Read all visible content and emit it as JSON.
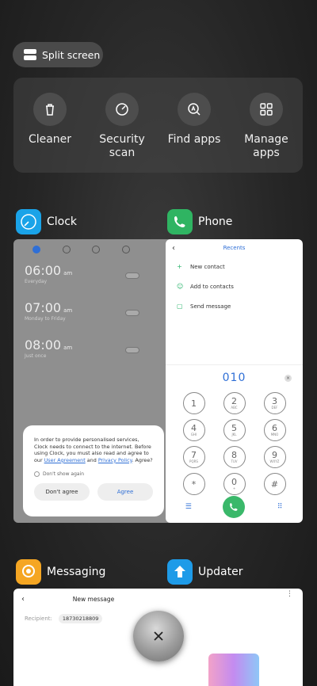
{
  "split_screen": {
    "label": "Split screen"
  },
  "quick_actions": [
    {
      "label": "Cleaner",
      "icon": "trash-icon"
    },
    {
      "label": "Security\nscan",
      "icon": "gauge-icon"
    },
    {
      "label": "Find apps",
      "icon": "search-icon"
    },
    {
      "label": "Manage\napps",
      "icon": "grid-icon"
    }
  ],
  "apps": {
    "clock": {
      "name": "Clock",
      "icon_color": "#1aa3e8",
      "alarms": [
        {
          "time": "06:00",
          "ampm": "am",
          "sub": "Everyday"
        },
        {
          "time": "07:00",
          "ampm": "am",
          "sub": "Monday to Friday"
        },
        {
          "time": "08:00",
          "ampm": "am",
          "sub": "Just once"
        }
      ],
      "dialog": {
        "message_start": "In order to provide personalised services, Clock needs to connect to the internet. Before using Clock, you must also read and agree to our ",
        "link1": "User Agreement",
        "and": " and ",
        "link2": "Privacy Policy",
        "message_end": ". Agree?",
        "checkbox": "Don't show again",
        "disagree": "Don't agree",
        "agree": "Agree"
      }
    },
    "phone": {
      "name": "Phone",
      "icon_color": "#2fb462",
      "title": "Recents",
      "rows": [
        "New contact",
        "Add to contacts",
        "Send message"
      ],
      "dialed": "010",
      "keys": [
        {
          "d": "1",
          "l": ""
        },
        {
          "d": "2",
          "l": "ABC"
        },
        {
          "d": "3",
          "l": "DEF"
        },
        {
          "d": "4",
          "l": "GHI"
        },
        {
          "d": "5",
          "l": "JKL"
        },
        {
          "d": "6",
          "l": "MNO"
        },
        {
          "d": "7",
          "l": "PQRS"
        },
        {
          "d": "8",
          "l": "TUV"
        },
        {
          "d": "9",
          "l": "WXYZ"
        },
        {
          "d": "*",
          "l": ""
        },
        {
          "d": "0",
          "l": "+"
        },
        {
          "d": "#",
          "l": ""
        }
      ]
    },
    "messaging": {
      "name": "Messaging",
      "icon_color": "#f5a623",
      "title": "New message",
      "recipient_label": "Recipient:",
      "recipient": "18730218809"
    },
    "updater": {
      "name": "Updater",
      "icon_color": "#1e9be8"
    }
  }
}
